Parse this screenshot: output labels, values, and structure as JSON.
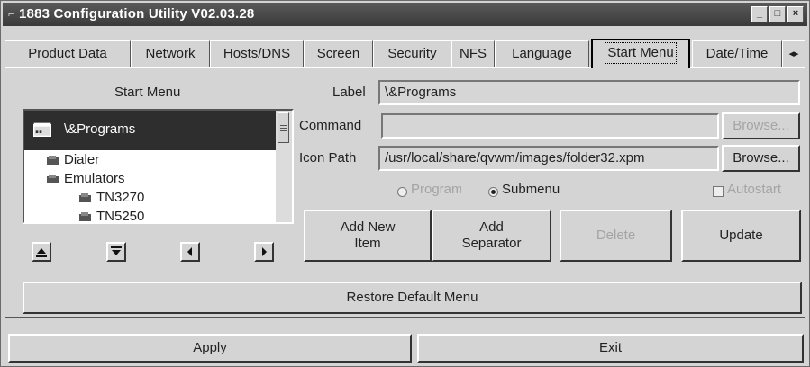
{
  "window": {
    "title": "1883 Configuration Utility V02.03.28",
    "controls": [
      "minimize-icon",
      "maximize-icon",
      "close-icon"
    ]
  },
  "tabs": [
    {
      "label": "Product Data",
      "active": false
    },
    {
      "label": "Network",
      "active": false
    },
    {
      "label": "Hosts/DNS",
      "active": false
    },
    {
      "label": "Screen",
      "active": false
    },
    {
      "label": "Security",
      "active": false
    },
    {
      "label": "NFS",
      "active": false
    },
    {
      "label": "Language",
      "active": false
    },
    {
      "label": "Start Menu",
      "active": true
    },
    {
      "label": "Date/Time",
      "active": false
    }
  ],
  "start_menu": {
    "heading": "Start Menu",
    "tree": {
      "selected": "\\&Programs",
      "items": [
        "Dialer",
        "Emulators",
        "TN3270",
        "TN5250"
      ]
    },
    "nav_buttons": [
      "up-arrow-icon",
      "down-arrow-icon",
      "left-arrow-icon",
      "right-arrow-icon"
    ]
  },
  "form": {
    "label_caption": "Label",
    "label_value": "\\&Programs",
    "command_caption": "Command",
    "command_value": "",
    "browse_label": "Browse...",
    "icon_path_caption": "Icon Path",
    "icon_path_value": "/usr/local/share/qvwm/images/folder32.xpm",
    "type_options": {
      "program": "Program",
      "submenu": "Submenu",
      "selected": "Submenu"
    },
    "autostart_label": "Autostart",
    "autostart_checked": false
  },
  "actions": {
    "add_new_item": [
      "Add New",
      "Item"
    ],
    "add_separator": [
      "Add",
      "Separator"
    ],
    "delete": "Delete",
    "update": "Update",
    "restore_default": "Restore Default Menu"
  },
  "footer": {
    "apply": "Apply",
    "exit": "Exit"
  },
  "colors": {
    "window_bg": "#d4d4d4",
    "title_bg": "#3f3f3f",
    "selection_bg": "#2e2e2e",
    "disabled_text": "#a4a4a4"
  }
}
